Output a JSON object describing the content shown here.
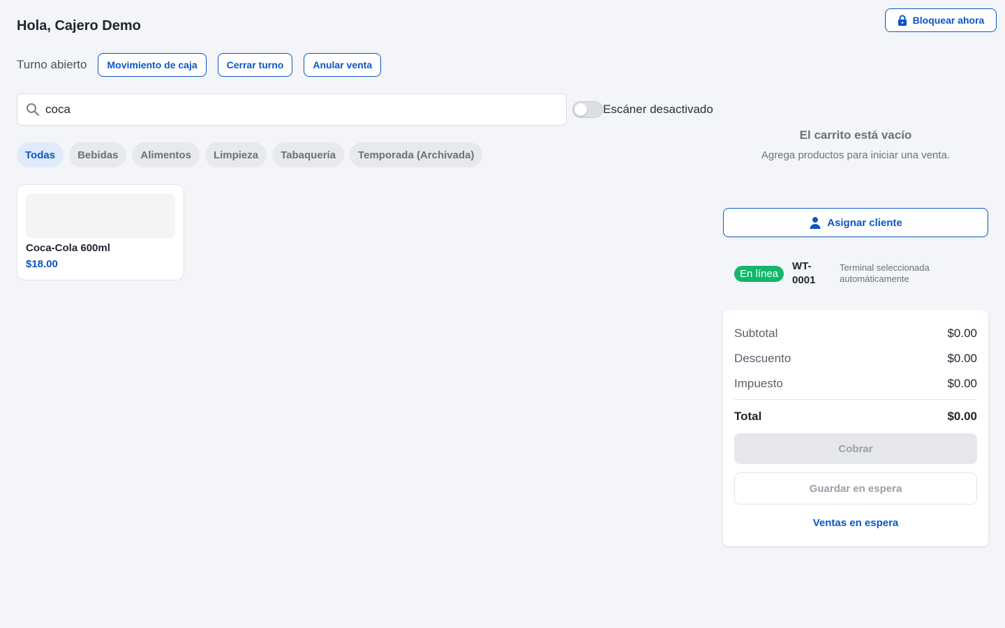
{
  "header": {
    "greeting": "Hola, Cajero Demo",
    "lock_label": "Bloquear ahora"
  },
  "shift": {
    "status": "Turno abierto",
    "actions": [
      {
        "label": "Movimiento de caja"
      },
      {
        "label": "Cerrar turno"
      },
      {
        "label": "Anular venta"
      }
    ]
  },
  "search": {
    "value": "coca",
    "placeholder": ""
  },
  "scanner": {
    "enabled": false,
    "label": "Escáner desactivado"
  },
  "categories": [
    {
      "label": "Todas",
      "active": true
    },
    {
      "label": "Bebidas",
      "active": false
    },
    {
      "label": "Alimentos",
      "active": false
    },
    {
      "label": "Limpieza",
      "active": false
    },
    {
      "label": "Tabaquería",
      "active": false
    },
    {
      "label": "Temporada (Archivada)",
      "active": false
    }
  ],
  "products": [
    {
      "name": "Coca-Cola 600ml",
      "price": "$18.00"
    }
  ],
  "cart": {
    "empty_title": "El carrito está vacío",
    "empty_subtitle": "Agrega productos para iniciar una venta.",
    "assign_label": "Asignar cliente"
  },
  "terminal": {
    "status": "En línea",
    "id": "WT-0001",
    "note": "Terminal seleccionada automáticamente"
  },
  "summary": {
    "subtotal_label": "Subtotal",
    "subtotal_value": "$0.00",
    "discount_label": "Descuento",
    "discount_value": "$0.00",
    "tax_label": "Impuesto",
    "tax_value": "$0.00",
    "total_label": "Total",
    "total_value": "$0.00",
    "pay_label": "Cobrar",
    "hold_label": "Guardar en espera",
    "held_sales_label": "Ventas en espera"
  },
  "colors": {
    "accent": "#0b57c4",
    "online": "#12b76a",
    "background": "#f3f5f8"
  },
  "icons": {
    "lock": "lock-icon",
    "search": "search-icon",
    "user": "user-icon"
  }
}
